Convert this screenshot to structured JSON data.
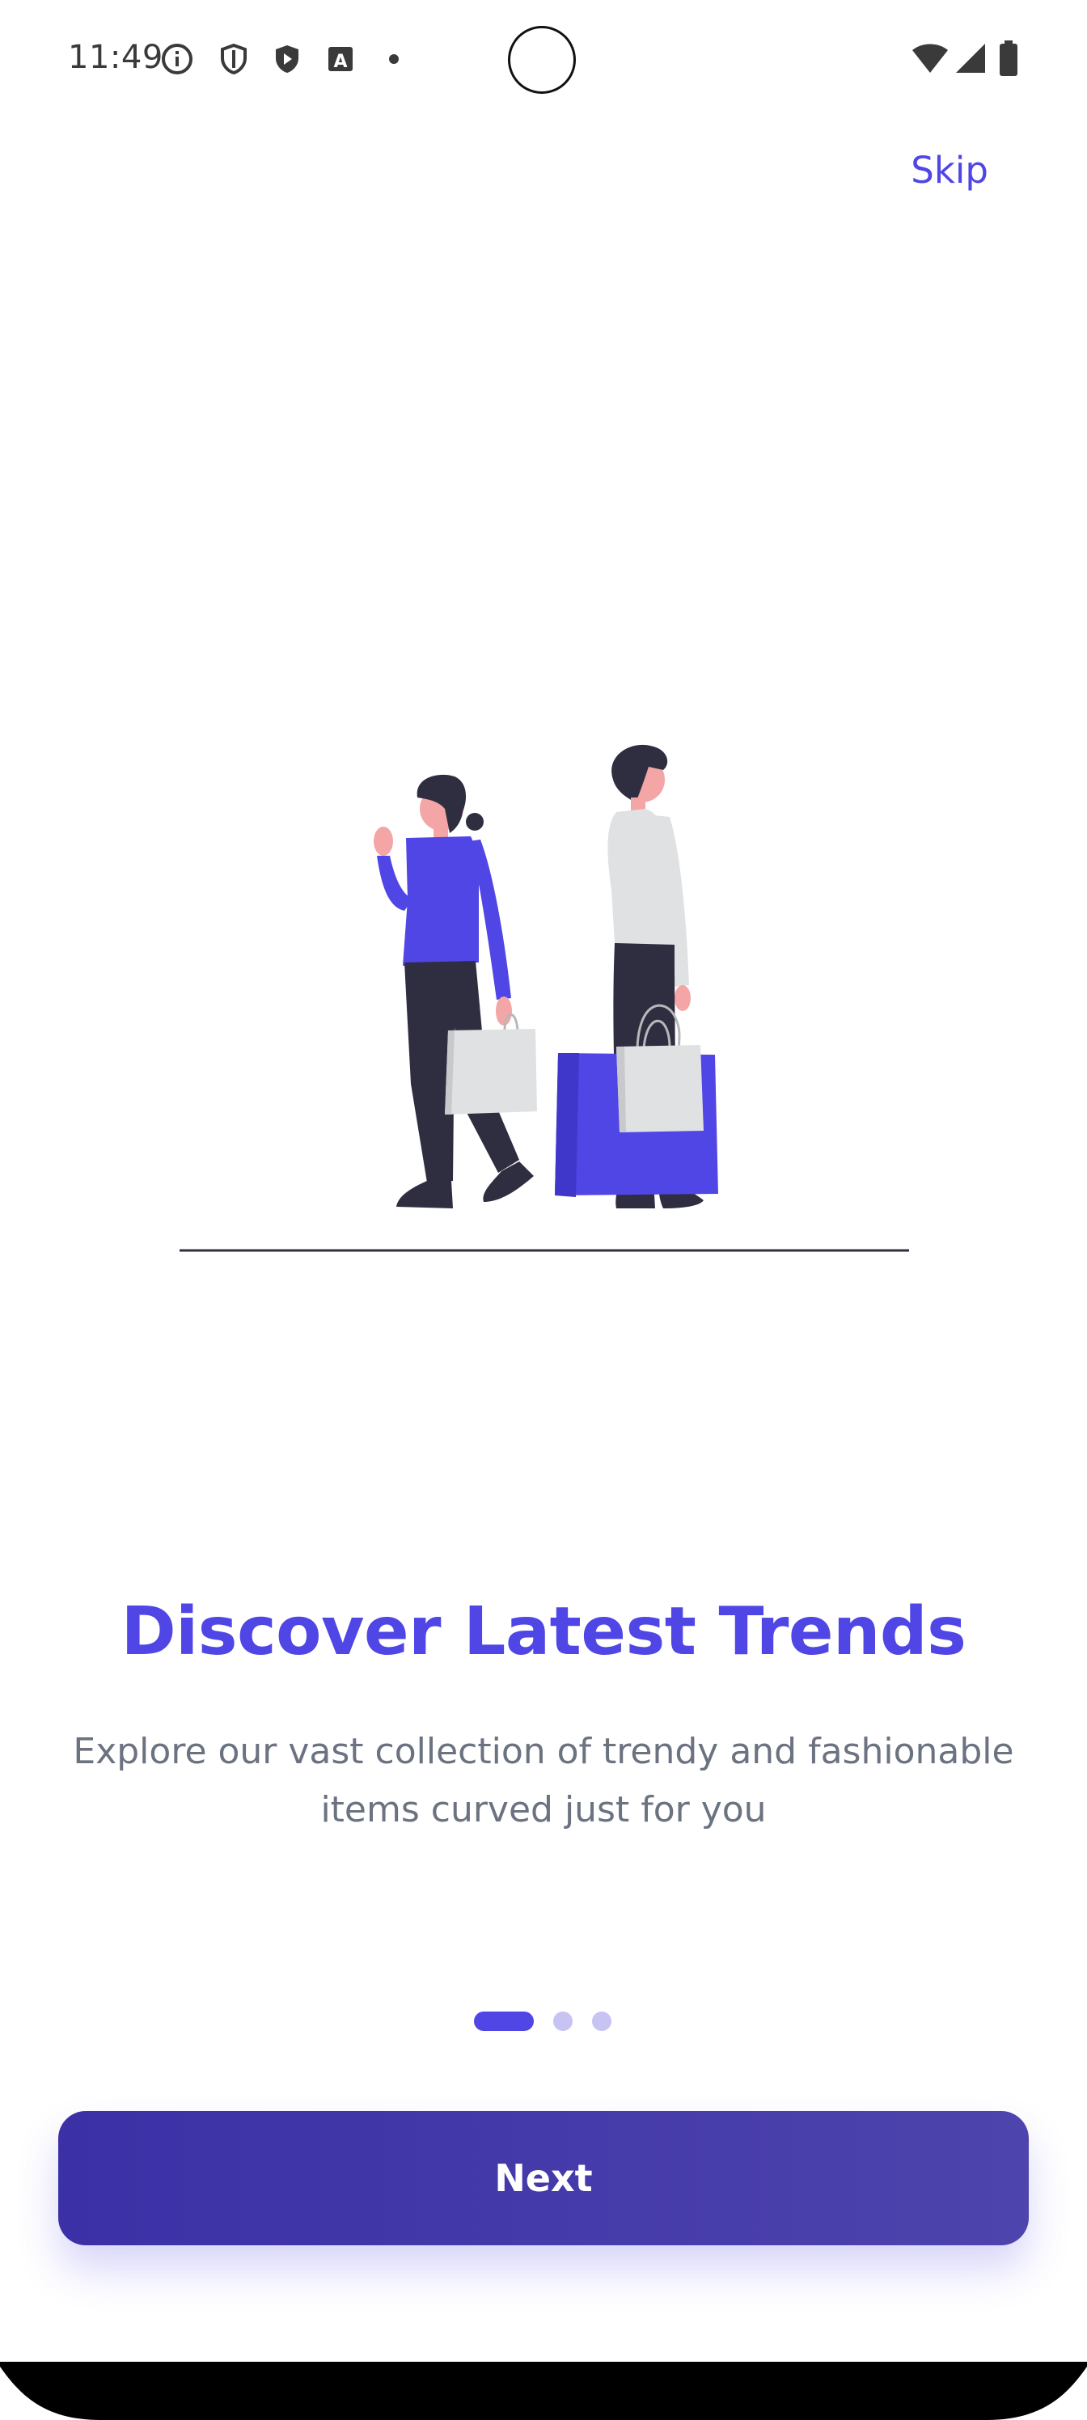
{
  "status_bar": {
    "time": "11:49",
    "icons": [
      "info-icon",
      "shield-icon",
      "play-protect-icon",
      "text-a-icon",
      "dot-icon"
    ],
    "right_icons": [
      "wifi-icon",
      "signal-icon",
      "battery-icon"
    ]
  },
  "header": {
    "skip_label": "Skip"
  },
  "onboarding": {
    "title": "Discover Latest Trends",
    "subtitle": "Explore our vast collection of trendy and fashionable items curved just for you",
    "illustration": "shopping-people-illustration",
    "page_indicator": {
      "current": 1,
      "total": 3
    }
  },
  "actions": {
    "next_label": "Next"
  },
  "colors": {
    "accent": "#4f46e5",
    "button_gradient_start": "#3b30a6",
    "button_gradient_end": "#4e44ad",
    "subtitle": "#6b7280",
    "indicator_inactive": "#c7c3f3",
    "illustration_dark": "#2f2e41",
    "illustration_light": "#e0e1e3",
    "skin": "#f4a5a5"
  }
}
